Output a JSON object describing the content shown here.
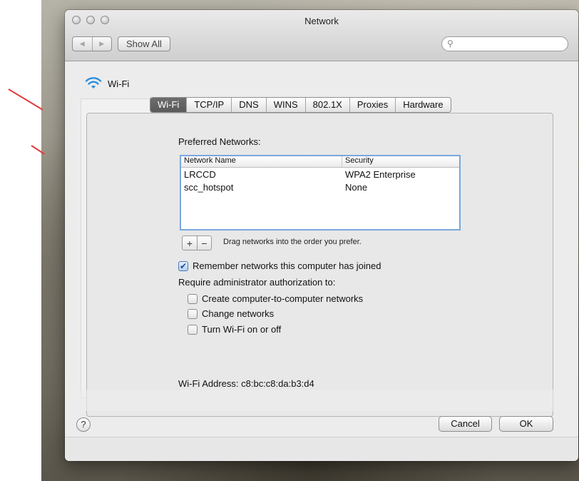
{
  "window": {
    "title": "Network"
  },
  "toolbar": {
    "show_all": "Show All",
    "search_placeholder": ""
  },
  "header": {
    "interface_name": "Wi-Fi"
  },
  "tabs": [
    {
      "label": "Wi-Fi",
      "active": true
    },
    {
      "label": "TCP/IP",
      "active": false
    },
    {
      "label": "DNS",
      "active": false
    },
    {
      "label": "WINS",
      "active": false
    },
    {
      "label": "802.1X",
      "active": false
    },
    {
      "label": "Proxies",
      "active": false
    },
    {
      "label": "Hardware",
      "active": false
    }
  ],
  "preferred": {
    "label": "Preferred Networks:",
    "columns": [
      "Network Name",
      "Security"
    ],
    "rows": [
      {
        "name": "LRCCD",
        "security": "WPA2 Enterprise"
      },
      {
        "name": "scc_hotspot",
        "security": "None"
      }
    ],
    "add_label": "+",
    "remove_label": "−",
    "drag_hint": "Drag networks into the order you prefer."
  },
  "options": {
    "remember": {
      "label": "Remember networks this computer has joined",
      "checked": true
    },
    "require_label": "Require administrator authorization to:",
    "items": [
      {
        "label": "Create computer-to-computer networks",
        "checked": false
      },
      {
        "label": "Change networks",
        "checked": false
      },
      {
        "label": "Turn Wi-Fi on or off",
        "checked": false
      }
    ]
  },
  "address": {
    "text": "Wi-Fi Address:  c8:bc:c8:da:b3:d4"
  },
  "footer": {
    "help": "?",
    "cancel": "Cancel",
    "ok": "OK"
  },
  "colors": {
    "selection_border": "#7aa7de",
    "annotation_red": "#e23b3b",
    "active_tab": "#5f5f5f"
  },
  "icons": {
    "wifi": "wifi-icon",
    "search": "search-icon",
    "help": "help-icon"
  }
}
